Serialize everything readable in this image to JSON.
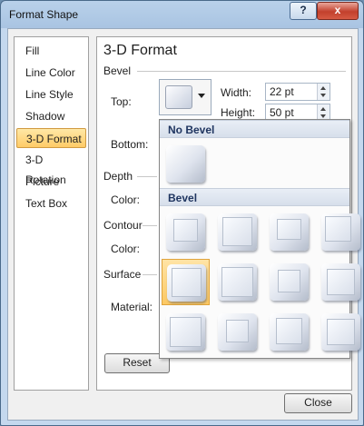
{
  "window": {
    "title": "Format Shape",
    "help_label": "?",
    "close_label": "x"
  },
  "nav": {
    "items": [
      {
        "label": "Fill",
        "active": false
      },
      {
        "label": "Line Color",
        "active": false
      },
      {
        "label": "Line Style",
        "active": false
      },
      {
        "label": "Shadow",
        "active": false
      },
      {
        "label": "3-D Format",
        "active": true
      },
      {
        "label": "3-D Rotation",
        "active": false
      },
      {
        "label": "Picture",
        "active": false
      },
      {
        "label": "Text Box",
        "active": false
      }
    ]
  },
  "panel": {
    "title": "3-D Format",
    "bevel": {
      "section": "Bevel",
      "top_label": "Top:",
      "bottom_label": "Bottom:",
      "width_label": "Width:",
      "width_value": "22 pt",
      "height_label": "Height:",
      "height_value": "50 pt"
    },
    "depth": {
      "section": "Depth",
      "color_label": "Color:"
    },
    "contour": {
      "section": "Contour",
      "color_label": "Color:"
    },
    "surface": {
      "section": "Surface",
      "material_label": "Material:"
    },
    "reset_label": "Reset"
  },
  "bevel_gallery": {
    "no_bevel_header": "No Bevel",
    "bevel_header": "Bevel",
    "selected_index": 4,
    "items": [
      "circle",
      "relaxed-inset",
      "cross",
      "cool-slant",
      "angle",
      "soft-round",
      "convex",
      "slope",
      "divot",
      "riblet",
      "hard-edge",
      "art-deco"
    ]
  },
  "footer": {
    "close_label": "Close"
  }
}
